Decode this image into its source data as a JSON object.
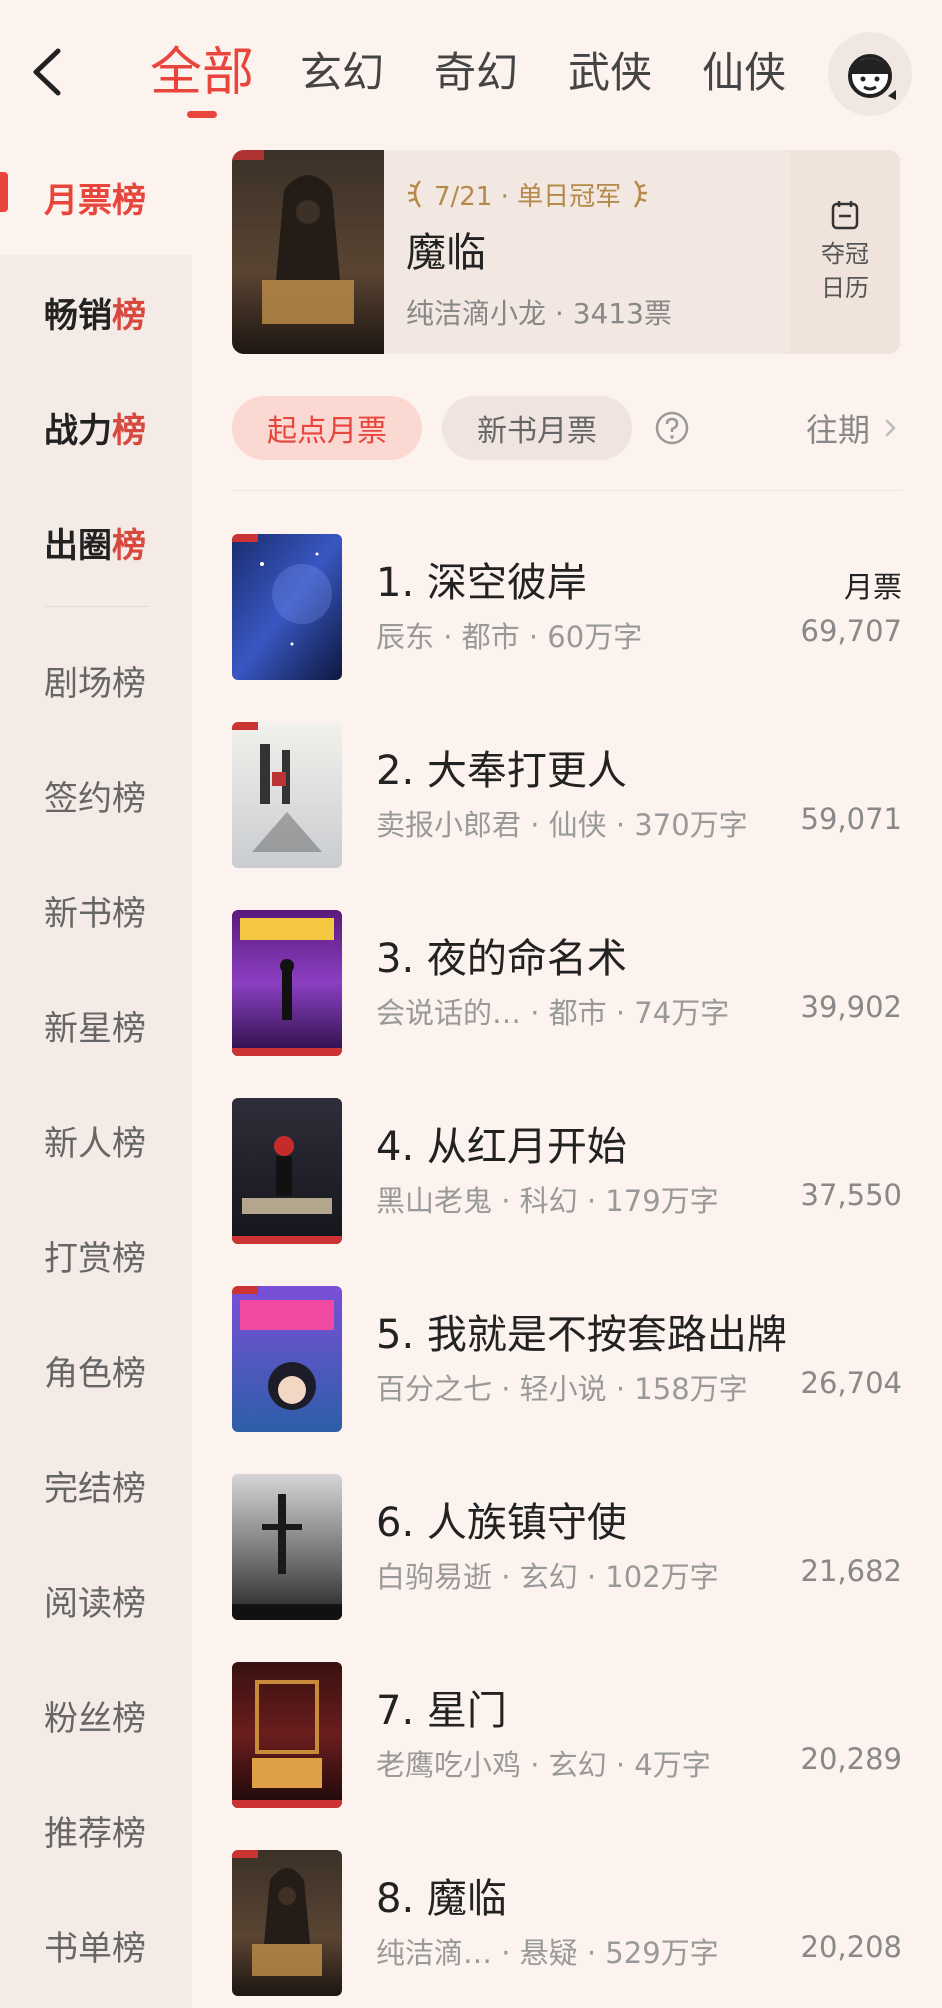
{
  "nav": {
    "tabs": [
      "全部",
      "玄幻",
      "奇幻",
      "武侠",
      "仙侠"
    ],
    "active_tab": "全部"
  },
  "sidebar": {
    "items": [
      {
        "prefix": "月票",
        "suffix": "榜"
      },
      {
        "prefix": "畅销",
        "suffix": "榜"
      },
      {
        "prefix": "战力",
        "suffix": "榜"
      },
      {
        "prefix": "出圈",
        "suffix": "榜"
      },
      {
        "prefix": "剧场",
        "suffix": "榜"
      },
      {
        "prefix": "签约",
        "suffix": "榜"
      },
      {
        "prefix": "新书",
        "suffix": "榜"
      },
      {
        "prefix": "新星",
        "suffix": "榜"
      },
      {
        "prefix": "新人",
        "suffix": "榜"
      },
      {
        "prefix": "打赏",
        "suffix": "榜"
      },
      {
        "prefix": "角色",
        "suffix": "榜"
      },
      {
        "prefix": "完结",
        "suffix": "榜"
      },
      {
        "prefix": "阅读",
        "suffix": "榜"
      },
      {
        "prefix": "粉丝",
        "suffix": "榜"
      },
      {
        "prefix": "推荐",
        "suffix": "榜"
      },
      {
        "prefix": "书单",
        "suffix": "榜"
      }
    ]
  },
  "champion": {
    "badge": "7/21 · 单日冠军",
    "title": "魔临",
    "subtitle": "纯洁滴小龙 · 3413票",
    "calendar_label_1": "夺冠",
    "calendar_label_2": "日历"
  },
  "filters": {
    "active": "起点月票",
    "inactive": "新书月票",
    "history": "往期"
  },
  "list": {
    "votes_header": "月票",
    "items": [
      {
        "title": "1. 深空彼岸",
        "meta": "辰东 · 都市 · 60万字",
        "votes": "69,707"
      },
      {
        "title": "2. 大奉打更人",
        "meta": "卖报小郎君 · 仙侠 · 370万字",
        "votes": "59,071"
      },
      {
        "title": "3. 夜的命名术",
        "meta": "会说话的…  · 都市 · 74万字",
        "votes": "39,902"
      },
      {
        "title": "4. 从红月开始",
        "meta": "黑山老鬼 · 科幻 · 179万字",
        "votes": "37,550"
      },
      {
        "title": "5. 我就是不按套路出牌",
        "meta": "百分之七 · 轻小说 · 158万字",
        "votes": "26,704"
      },
      {
        "title": "6. 人族镇守使",
        "meta": "白驹易逝 · 玄幻 · 102万字",
        "votes": "21,682"
      },
      {
        "title": "7. 星门",
        "meta": "老鹰吃小鸡 · 玄幻 · 4万字",
        "votes": "20,289"
      },
      {
        "title": "8. 魔临",
        "meta": "纯洁滴…  · 悬疑 · 529万字",
        "votes": "20,208"
      }
    ]
  },
  "colors": {
    "accent": "#e8453c",
    "background": "#fcf3ee",
    "sidebar": "#f5ebe6"
  }
}
